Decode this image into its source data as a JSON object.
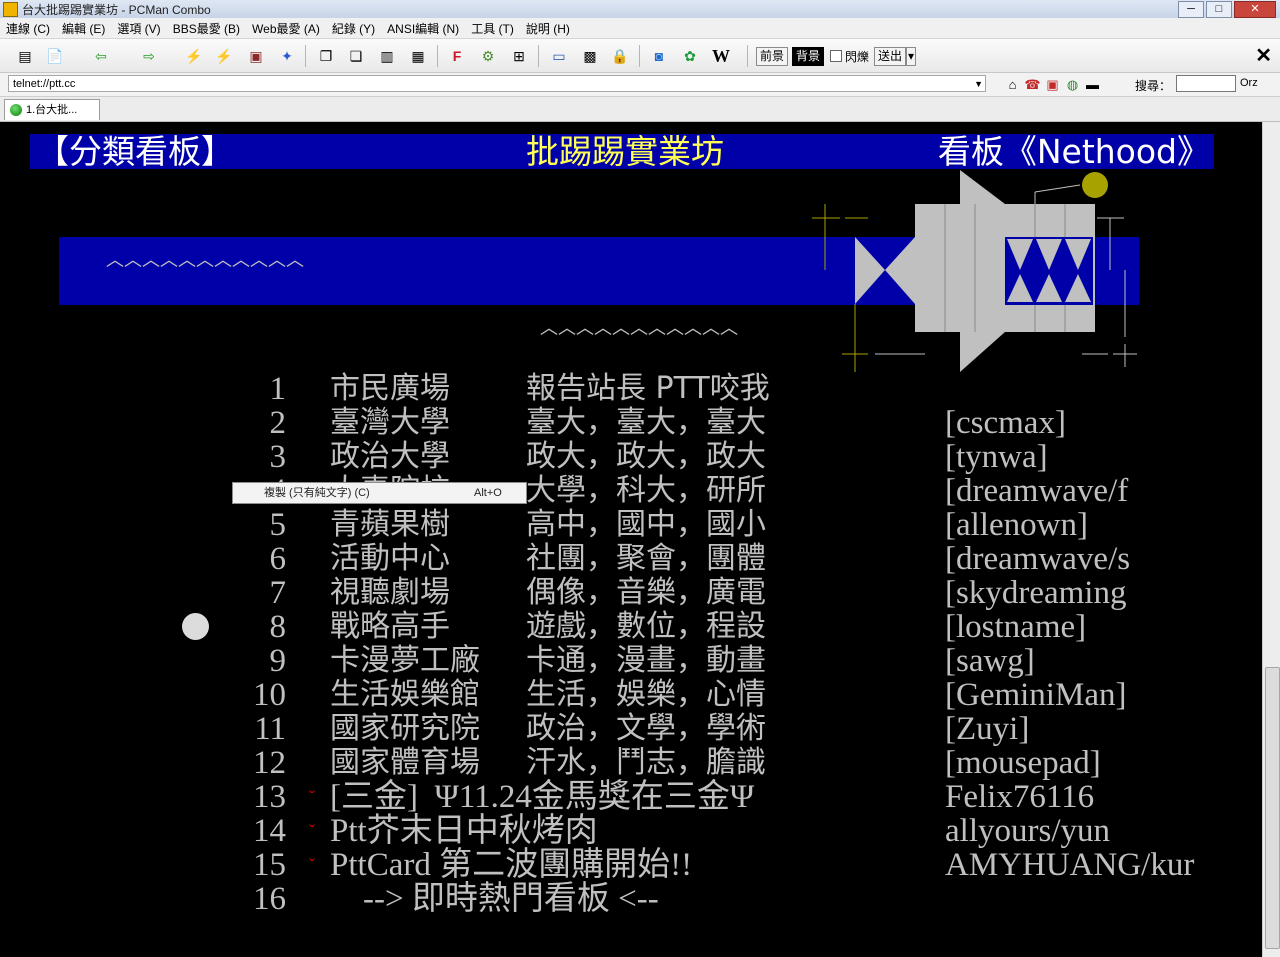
{
  "window": {
    "title": "台大批踢踢實業坊 - PCMan Combo",
    "buttons": [
      "─",
      "□",
      "✕"
    ]
  },
  "menu": [
    "連線 (C)",
    "編輯 (E)",
    "選項 (V)",
    "BBS最愛 (B)",
    "Web最愛 (A)",
    "紀錄 (Y)",
    "ANSI編輯 (N)",
    "工具 (T)",
    "說明 (H)"
  ],
  "toolbar": {
    "icons": [
      "new-site-icon",
      "new-tab-icon",
      "back-icon",
      "forward-icon",
      "reconnect-icon",
      "disconnect-icon",
      "close-site-icon",
      "add-favorite-icon",
      "copy-icon",
      "paste-icon",
      "copy-with-color-icon",
      "download-icon",
      "font-icon",
      "settings-icon",
      "fullscreen-icon",
      "screen-icon",
      "emoticon-icon",
      "lock-icon",
      "open-browser-icon",
      "flower-icon",
      "wikipedia-icon"
    ],
    "fg_label": "前景",
    "bg_label": "背景",
    "blink_label": "閃爍",
    "send_label": "送出"
  },
  "address": {
    "value": "telnet://ptt.cc"
  },
  "search": {
    "label": "搜尋：",
    "engine": "Orz"
  },
  "tab": {
    "label": "1.台大批..."
  },
  "board_header": {
    "left": "【分類看板】",
    "center": "批踢踢實業坊",
    "right": "看板《Nethood》"
  },
  "art": {
    "wave1": "︿︿︿︿︿︿︿︿︿︿︿",
    "wave2": "︿︿︿︿︿︿︿︿︿︿︿"
  },
  "rows": [
    {
      "num": "1",
      "name": "市民廣場",
      "desc": "報告站長 PTT咬我",
      "mod": ""
    },
    {
      "num": "2",
      "name": "臺灣大學",
      "desc": "臺大，臺大，臺大",
      "mod": "[cscmax]"
    },
    {
      "num": "3",
      "name": "政治大學",
      "desc": "政大，政大，政大",
      "mod": "[tynwa]"
    },
    {
      "num": "4",
      "name": "大專院校",
      "desc": "大學，科大，研所",
      "mod": "[dreamwave/f"
    },
    {
      "num": "5",
      "name": "青蘋果樹",
      "desc": "高中，國中，國小",
      "mod": "[allenown]"
    },
    {
      "num": "6",
      "name": "活動中心",
      "desc": "社團，聚會，團體",
      "mod": "[dreamwave/s"
    },
    {
      "num": "7",
      "name": "視聽劇場",
      "desc": "偶像，音樂，廣電",
      "mod": "[skydreaming"
    },
    {
      "num": "8",
      "name": "戰略高手",
      "desc": "遊戲，數位，程設",
      "mod": "[lostname]"
    },
    {
      "num": "9",
      "name": "卡漫夢工廠",
      "desc": "卡通，漫畫，動畫",
      "mod": "[sawg]"
    },
    {
      "num": "10",
      "name": "生活娛樂館",
      "desc": "生活，娛樂，心情",
      "mod": "[GeminiMan]"
    },
    {
      "num": "11",
      "name": "國家研究院",
      "desc": "政治，文學，學術",
      "mod": "[Zuyi]"
    },
    {
      "num": "12",
      "name": "國家體育場",
      "desc": "汗水，鬥志，膽識",
      "mod": "[mousepad]"
    }
  ],
  "hot_rows": [
    {
      "num": "13",
      "mark": "ˇ",
      "text": "[三金]  Ψ11.24金馬獎在三金Ψ",
      "mod": "Felix76116"
    },
    {
      "num": "14",
      "mark": "ˇ",
      "text": "Ptt芥末日中秋烤肉",
      "mod": "allyours/yun"
    },
    {
      "num": "15",
      "mark": "ˇ",
      "text": "PttCard 第二波團購開始!!",
      "mod": "AMYHUANG/kur"
    }
  ],
  "last_row": {
    "num": "16",
    "text": "    --> 即時熱門看板 <--"
  },
  "context_menu": {
    "label": "複製 (只有純文字) (C)",
    "shortcut": "Alt+O"
  }
}
